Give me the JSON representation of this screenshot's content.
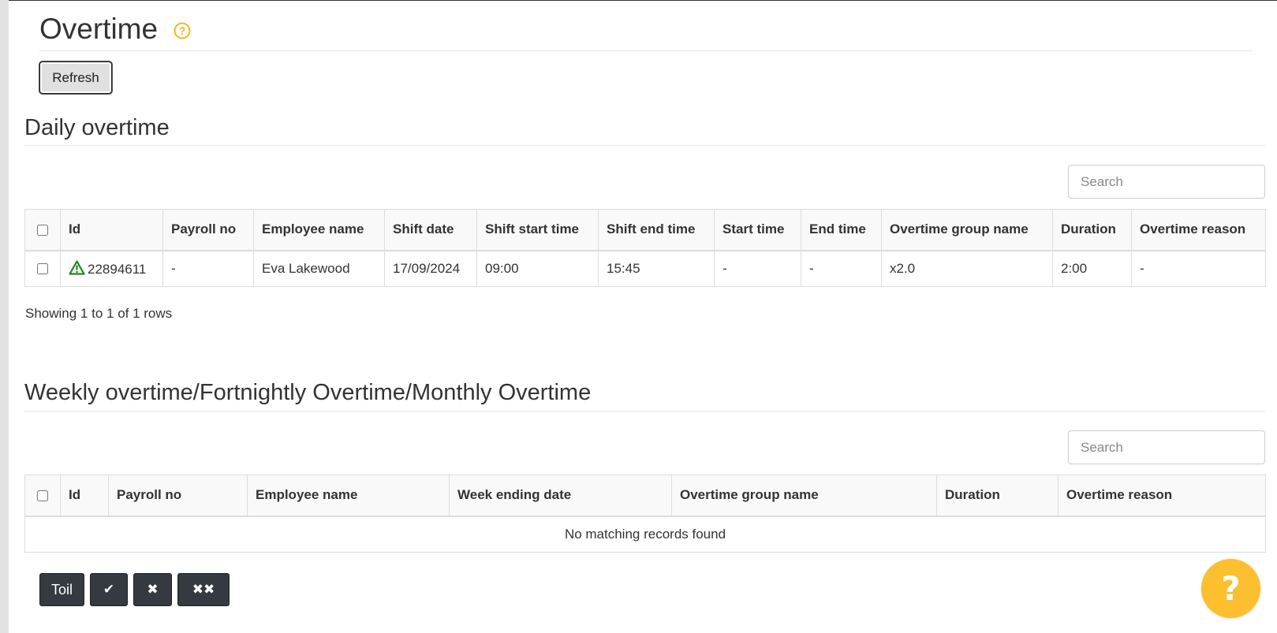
{
  "page": {
    "title": "Overtime",
    "refresh_label": "Refresh"
  },
  "daily": {
    "title": "Daily overtime",
    "search_placeholder": "Search",
    "columns": [
      "Id",
      "Payroll no",
      "Employee name",
      "Shift date",
      "Shift start time",
      "Shift end time",
      "Start time",
      "End time",
      "Overtime group name",
      "Duration",
      "Overtime reason"
    ],
    "rows": [
      {
        "id": "22894611",
        "payroll_no": "-",
        "employee_name": "Eva Lakewood",
        "shift_date": "17/09/2024",
        "shift_start": "09:00",
        "shift_end": "15:45",
        "start_time": "-",
        "end_time": "-",
        "overtime_group": "x2.0",
        "duration": "2:00",
        "reason": "-"
      }
    ],
    "pagination": "Showing 1 to 1 of 1 rows"
  },
  "weekly": {
    "title": "Weekly overtime/Fortnightly Overtime/Monthly Overtime",
    "search_placeholder": "Search",
    "columns": [
      "Id",
      "Payroll no",
      "Employee name",
      "Week ending date",
      "Overtime group name",
      "Duration",
      "Overtime reason"
    ],
    "empty_message": "No matching records found"
  },
  "toolbar": {
    "toil_label": "Toil",
    "approve_glyph": "✔",
    "reject_glyph": "✖",
    "reject_all_glyph": "✖✖"
  },
  "help_fab": {
    "glyph": "?"
  },
  "colors": {
    "help_accent": "#fcc02e",
    "warning_icon": "#1a8a1a",
    "toolbar_button": "#343a40"
  }
}
